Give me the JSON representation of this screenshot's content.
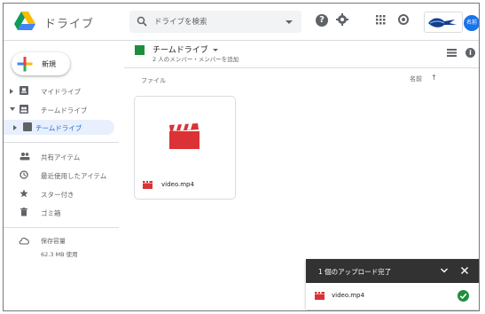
{
  "app": {
    "name": "ドライブ"
  },
  "search": {
    "placeholder": "ドライブを検索"
  },
  "account": {
    "avatar_text": "名前"
  },
  "sidebar": {
    "new_button": "新規",
    "items": [
      {
        "label": "マイドライブ",
        "icon": "my-drive-icon"
      },
      {
        "label": "チームドライブ",
        "icon": "team-drives-icon"
      },
      {
        "label": "チームドライブ",
        "icon": "team-drive-icon"
      },
      {
        "label": "共有アイテム",
        "icon": "people-icon"
      },
      {
        "label": "最近使用したアイテム",
        "icon": "clock-icon"
      },
      {
        "label": "スター付き",
        "icon": "star-icon"
      },
      {
        "label": "ゴミ箱",
        "icon": "trash-icon"
      }
    ],
    "storage": {
      "label": "保存容量",
      "used": "62.3 MB 使用"
    }
  },
  "main": {
    "drive_title": "チームドライブ",
    "drive_subtitle": "2 人のメンバー・メンバーを追加",
    "section_label": "ファイル",
    "sort_label": "名前",
    "files": [
      {
        "name": "video.mp4",
        "type": "video"
      }
    ]
  },
  "upload": {
    "title": "1 個のアップロード完了",
    "items": [
      {
        "name": "video.mp4",
        "status": "complete"
      }
    ]
  },
  "colors": {
    "accent": "#1a73e8",
    "selected_bg": "#e8f0fe",
    "video_red": "#db3236",
    "success": "#1e8e3e"
  }
}
